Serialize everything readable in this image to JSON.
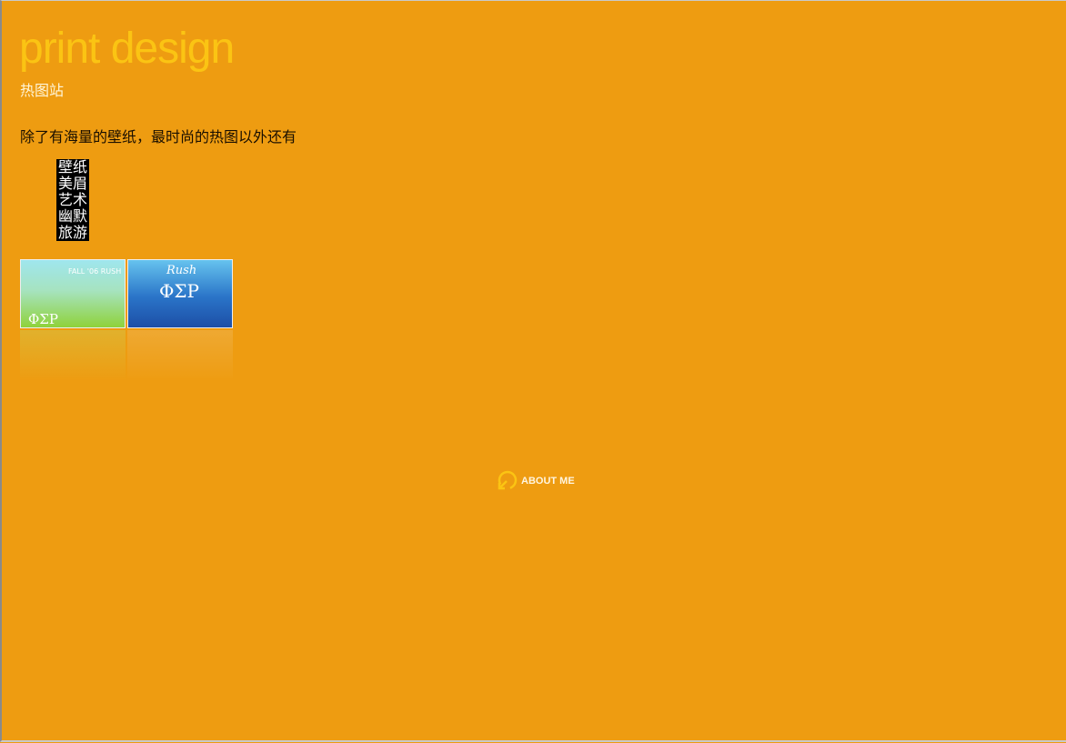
{
  "header": {
    "title": "print design",
    "subtitle": "热图站"
  },
  "intro": "除了有海量的壁纸，最时尚的热图以外还有",
  "menu": [
    {
      "label": "壁纸"
    },
    {
      "label": "美眉"
    },
    {
      "label": "艺术"
    },
    {
      "label": "幽默"
    },
    {
      "label": "旅游"
    }
  ],
  "gallery": [
    {
      "heading": "FALL '06 RUSH",
      "letters": "ΦΣΡ"
    },
    {
      "heading": "Rush",
      "letters": "ΦΣΡ"
    }
  ],
  "about": {
    "label": "ABOUT ME",
    "icon": "circular-arrow-icon"
  },
  "colors": {
    "background": "#ee9c11",
    "title": "#fbc413"
  }
}
